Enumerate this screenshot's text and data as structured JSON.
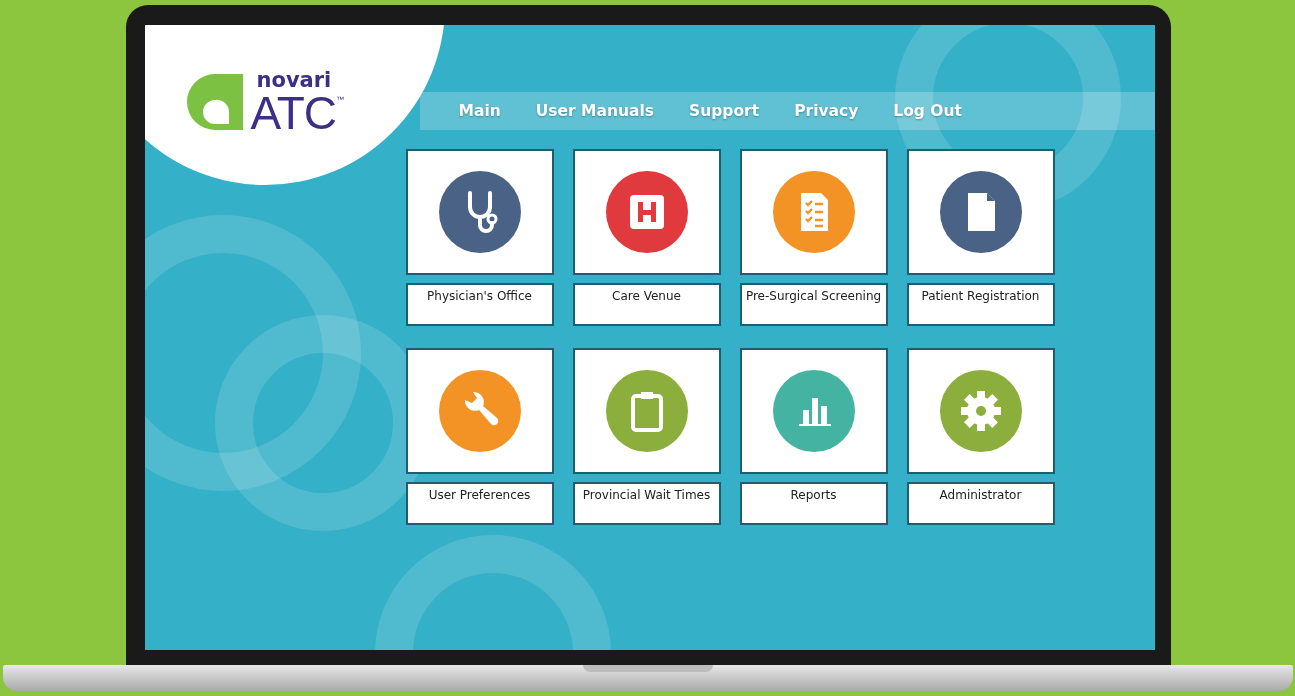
{
  "logo": {
    "brand": "novari",
    "product": "ATC",
    "trademark": "™"
  },
  "nav": [
    {
      "label": "Main"
    },
    {
      "label": "User Manuals"
    },
    {
      "label": "Support"
    },
    {
      "label": "Privacy"
    },
    {
      "label": "Log Out"
    }
  ],
  "tiles": [
    {
      "label": "Physician's Office",
      "kind": "stethoscope",
      "color": "#4a6285"
    },
    {
      "label": "Care Venue",
      "kind": "hospital",
      "color": "#e0393e"
    },
    {
      "label": "Pre-Surgical Screening",
      "kind": "checklist",
      "color": "#f39325"
    },
    {
      "label": "Patient Registration",
      "kind": "document",
      "color": "#4a6285"
    },
    {
      "label": "User Preferences",
      "kind": "wrench",
      "color": "#f39325"
    },
    {
      "label": "Provincial Wait Times",
      "kind": "clipboard",
      "color": "#8cae3d"
    },
    {
      "label": "Reports",
      "kind": "chart",
      "color": "#45b3a2"
    },
    {
      "label": "Administrator",
      "kind": "gear",
      "color": "#8cae3d"
    }
  ]
}
